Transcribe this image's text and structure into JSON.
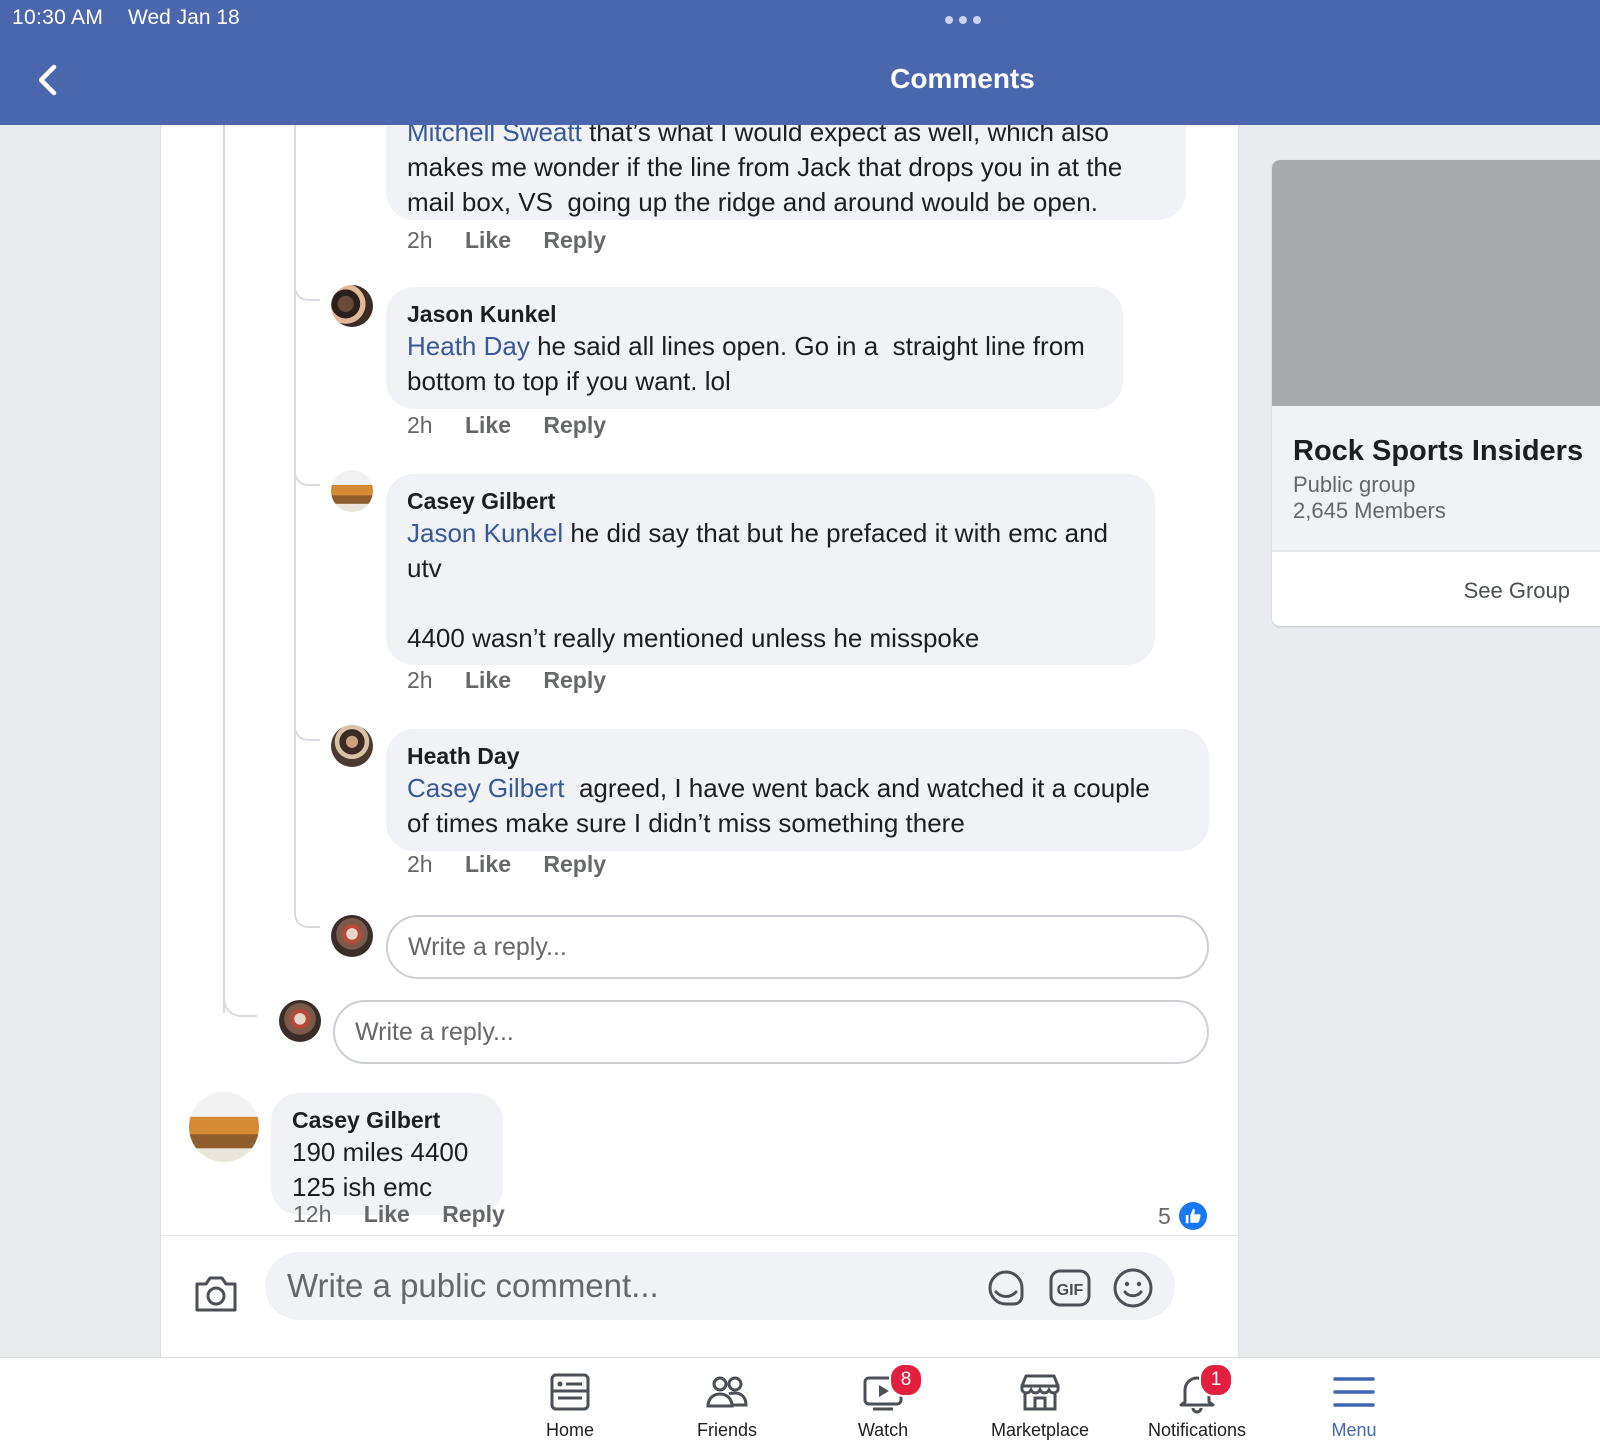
{
  "status_bar": {
    "time": "10:30 AM",
    "date": "Wed Jan 18"
  },
  "header": {
    "title": "Comments"
  },
  "comments": {
    "first": {
      "partial_line": "Mitchell Sweatt that’s what I would expect as well, which also",
      "mention": "Mitchell Sweatt",
      "text": "makes me wonder if the line from Jack that drops you in at the\nmail box, VS  going up the ridge and around would be open.",
      "time": "2h",
      "like": "Like",
      "reply": "Reply"
    },
    "jason": {
      "author": "Jason Kunkel",
      "mention": "Heath Day",
      "text": " he said all lines open. Go in a  straight line from\nbottom to top if you want. lol",
      "time": "2h",
      "like": "Like",
      "reply": "Reply"
    },
    "casey1": {
      "author": "Casey Gilbert",
      "mention": "Jason Kunkel",
      "text": " he did say that but he prefaced it with emc and\nutv\n\n4400 wasn’t really mentioned unless he misspoke",
      "time": "2h",
      "like": "Like",
      "reply": "Reply"
    },
    "heath": {
      "author": "Heath Day",
      "mention": "Casey Gilbert",
      "text": "  agreed, I have went back and watched it a couple\nof times make sure I didn’t miss something there",
      "time": "2h",
      "like": "Like",
      "reply": "Reply"
    },
    "reply_placeholder_inner": "Write a reply...",
    "reply_placeholder_outer": "Write a reply...",
    "casey2": {
      "author": "Casey Gilbert",
      "text": "190 miles 4400\n125 ish emc",
      "time": "12h",
      "like": "Like",
      "reply": "Reply",
      "reaction_count": "5"
    }
  },
  "composer": {
    "placeholder": "Write a public comment..."
  },
  "group": {
    "name": "Rock Sports Insiders",
    "type": "Public group",
    "members": "2,645 Members",
    "see_group": "See Group"
  },
  "nav": {
    "home": "Home",
    "friends": "Friends",
    "watch": "Watch",
    "watch_badge": "8",
    "marketplace": "Marketplace",
    "notifications": "Notifications",
    "notifications_badge": "1",
    "menu": "Menu"
  },
  "colors": {
    "header_blue": "#4a67ad",
    "link_blue": "#385898",
    "like_blue": "#1877f2",
    "badge_red": "#e41e3f"
  }
}
